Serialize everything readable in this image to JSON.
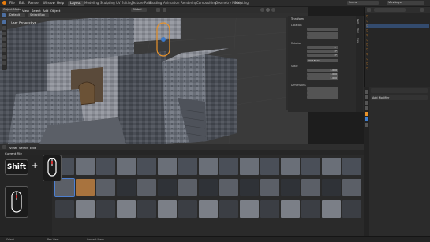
{
  "menubar": {
    "items": [
      "File",
      "Edit",
      "Render",
      "Window",
      "Help"
    ],
    "tabs": [
      "Layout",
      "Modeling",
      "Sculpting",
      "UV Editing",
      "Texture Paint",
      "Shading",
      "Animation",
      "Rendering",
      "Compositing",
      "Geometry Nodes",
      "Scripting"
    ],
    "active_tab": "Layout",
    "scene_label": "Scene",
    "viewlayer_label": "ViewLayer"
  },
  "viewport": {
    "mode": "Object Mode",
    "menus": [
      "View",
      "Select",
      "Add",
      "Object"
    ],
    "transform": "Global",
    "view_name": "User Perspective",
    "collection_info": "",
    "orientation_label": "Default",
    "drag_label": "Select Box"
  },
  "npanel": {
    "tabs": [
      "Item",
      "Tool",
      "View"
    ],
    "header": "Transform",
    "location_label": "Location",
    "rotation_label": "Rotation",
    "scale_label": "Scale",
    "dimensions_label": "Dimensions",
    "mode_value": "XYZ Euler",
    "location": [
      "",
      "",
      ""
    ],
    "rotation": [
      "0°",
      "0°",
      "0°"
    ],
    "scale": [
      "1.000",
      "1.000",
      "1.000"
    ],
    "dimensions": [
      "",
      "",
      ""
    ]
  },
  "outliner": {
    "rows": [
      "",
      "",
      "",
      "",
      "",
      "",
      "",
      "",
      "",
      "",
      "",
      ""
    ],
    "selected_index": 2
  },
  "properties": {
    "object_name": "",
    "section_header": "Add Modifier"
  },
  "asset_browser": {
    "menus": [
      "View",
      "Select",
      "Edit"
    ],
    "library": "Current File",
    "row1_labels": [
      "",
      "",
      "",
      "",
      "",
      "",
      "",
      "",
      "",
      "",
      "",
      "",
      "",
      "",
      ""
    ],
    "row2_labels": [
      "",
      "",
      "",
      "",
      "",
      "",
      "",
      "",
      "",
      "",
      "",
      "",
      "",
      "",
      ""
    ],
    "row3_labels": [
      "",
      "",
      "",
      "",
      "",
      "",
      "",
      "",
      "",
      "",
      "",
      "",
      "",
      "",
      ""
    ]
  },
  "overlay_keys": {
    "shift_label": "Shift",
    "plus": "+"
  },
  "statusbar": {
    "left": [
      "Select",
      "Pan View",
      "Context Menu"
    ],
    "right": ""
  }
}
